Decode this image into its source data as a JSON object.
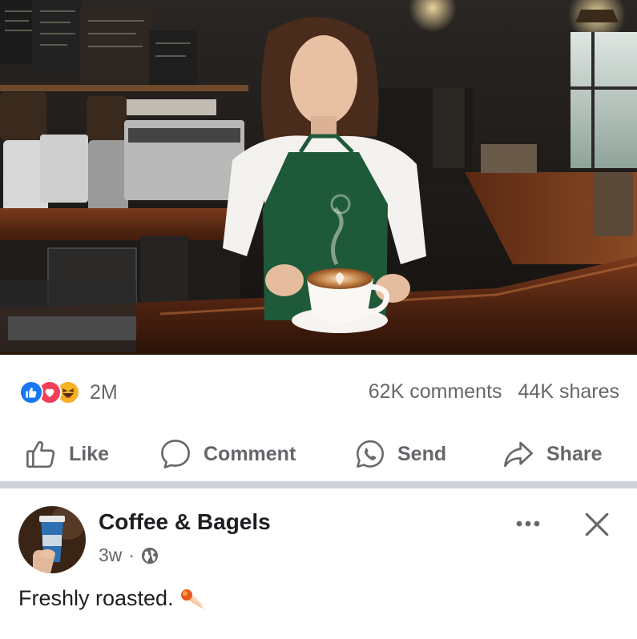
{
  "stats": {
    "reaction_count": "2M",
    "comments": "62K comments",
    "shares": "44K shares",
    "reaction_icons": [
      "like-icon",
      "love-icon",
      "haha-icon"
    ]
  },
  "actions": {
    "like": "Like",
    "comment": "Comment",
    "send": "Send",
    "share": "Share"
  },
  "post": {
    "page_name": "Coffee & Bagels",
    "time": "3w",
    "separator": "·",
    "caption": "Freshly roasted.",
    "caption_emoji": "comet"
  },
  "colors": {
    "like_blue": "#1877f2",
    "love_red": "#f33e58",
    "haha_yellow": "#f7b125",
    "secondary_text": "#65676b",
    "apron_green": "#1e5a3a"
  }
}
